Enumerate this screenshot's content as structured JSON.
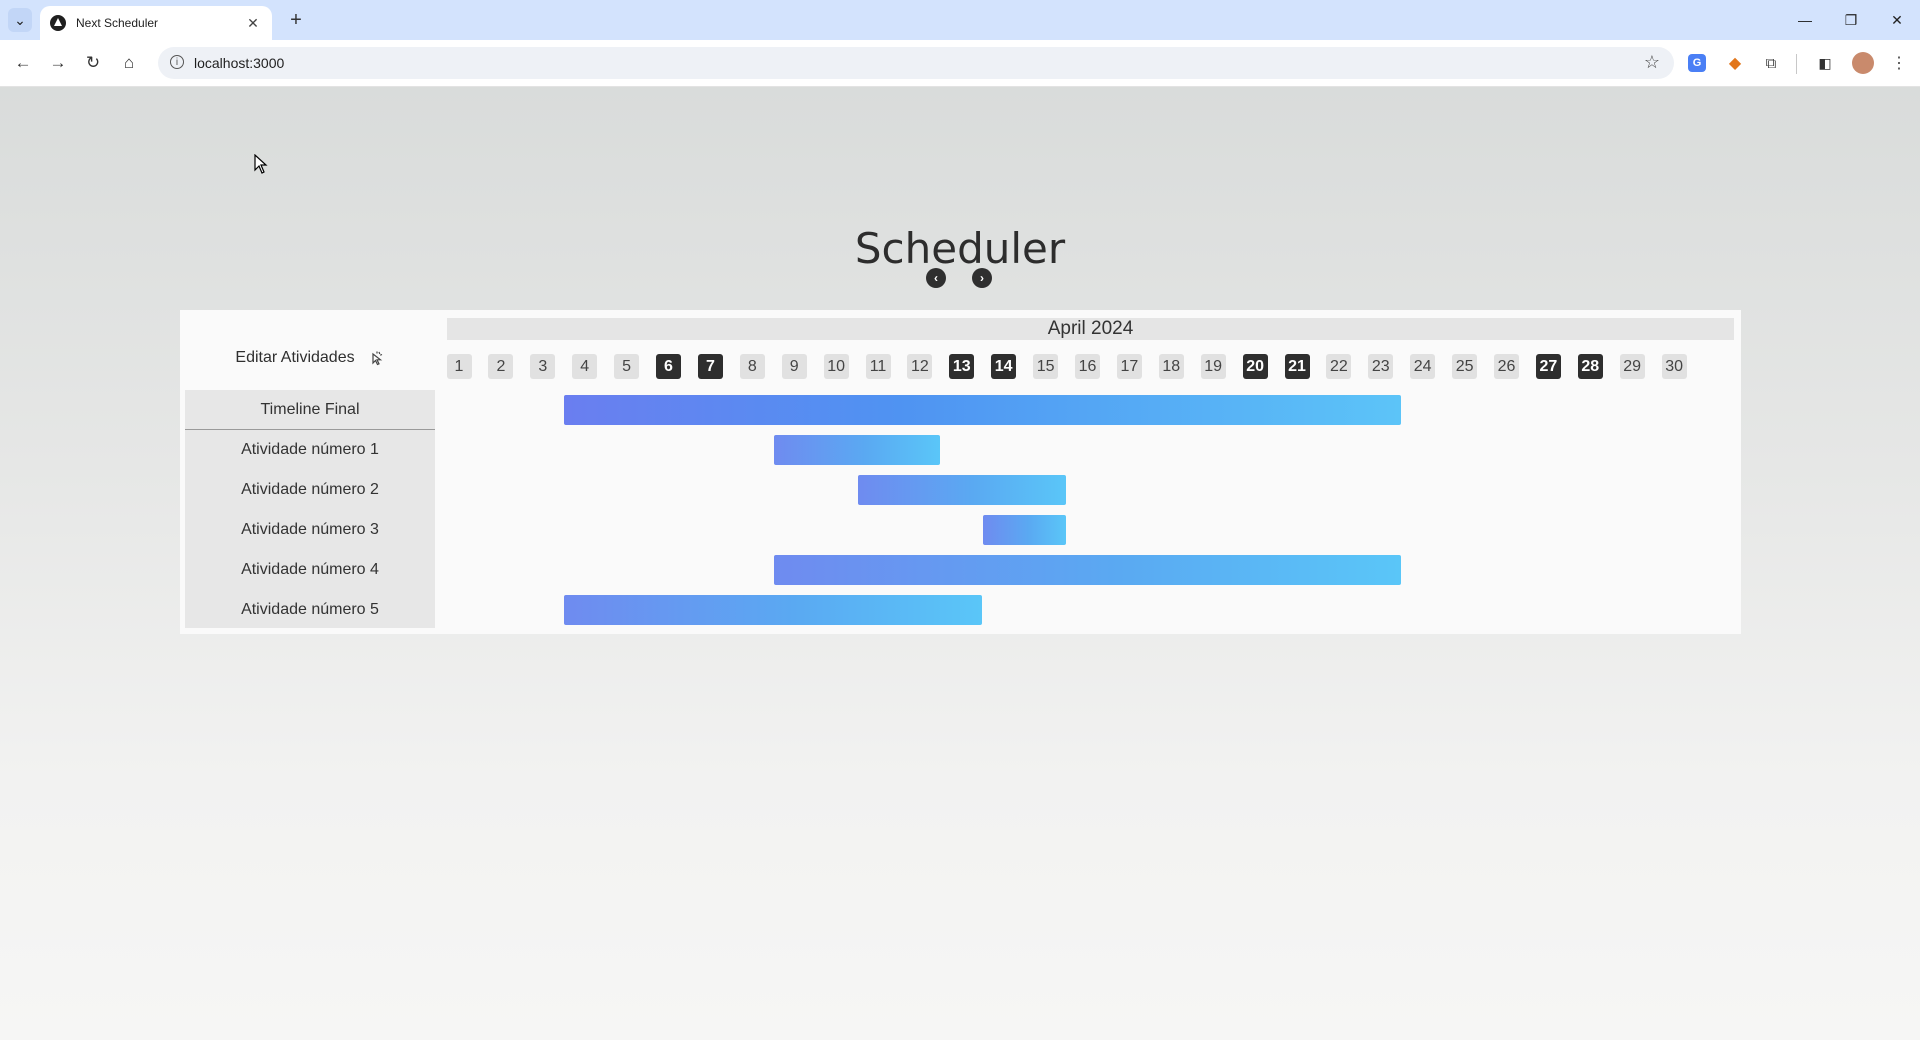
{
  "browser": {
    "tab_title": "Next Scheduler",
    "url": "localhost:3000",
    "new_tab_symbol": "+",
    "close_symbol": "✕"
  },
  "page": {
    "title": "Scheduler",
    "edit_label": "Editar Atividades",
    "month_label": "April 2024"
  },
  "days": [
    1,
    2,
    3,
    4,
    5,
    6,
    7,
    8,
    9,
    10,
    11,
    12,
    13,
    14,
    15,
    16,
    17,
    18,
    19,
    20,
    21,
    22,
    23,
    24,
    25,
    26,
    27,
    28,
    29,
    30
  ],
  "weekend_days": [
    6,
    7,
    13,
    14,
    20,
    21,
    27,
    28
  ],
  "rows": [
    {
      "label": "Timeline Final",
      "start": 4,
      "end": 23
    },
    {
      "label": "Atividade número 1",
      "start": 9,
      "end": 12
    },
    {
      "label": "Atividade número 2",
      "start": 11,
      "end": 15
    },
    {
      "label": "Atividade número 3",
      "start": 14,
      "end": 15
    },
    {
      "label": "Atividade número 4",
      "start": 9,
      "end": 23
    },
    {
      "label": "Atividade número 5",
      "start": 4,
      "end": 13
    }
  ],
  "colors": {
    "bar_start": "#6f8bf0",
    "bar_end": "#5ac6f8",
    "weekend_bg": "#2e2e2e",
    "weekday_bg": "#e1e1e1"
  }
}
